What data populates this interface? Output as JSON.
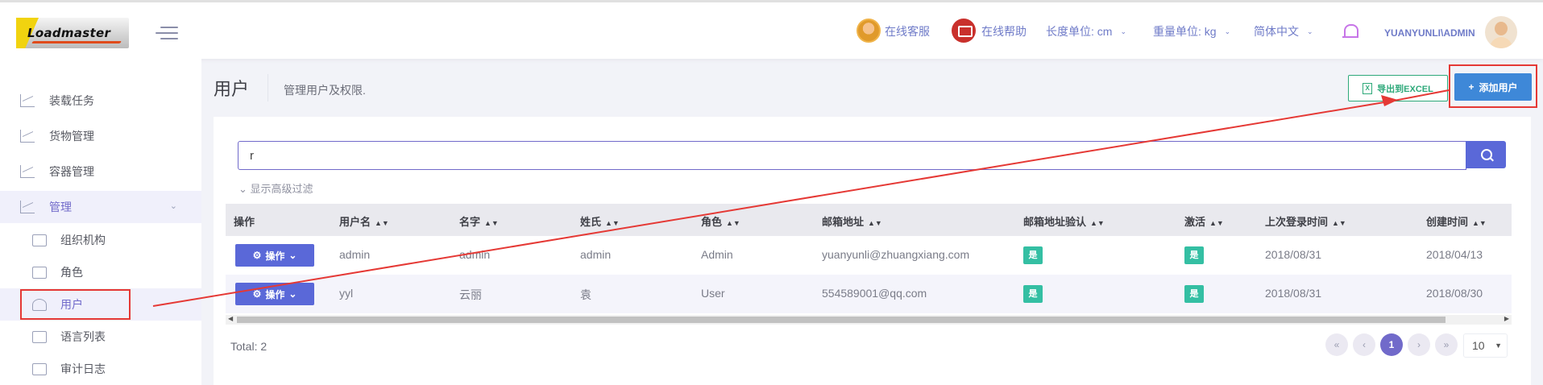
{
  "header": {
    "logo_text": "Loadmaster",
    "online_service": "在线客服",
    "online_help": "在线帮助",
    "length_unit": "长度单位: cm",
    "weight_unit": "重量单位: kg",
    "language": "简体中文",
    "user": "YUANYUNLI\\ADMIN"
  },
  "sidebar": {
    "items": [
      {
        "label": "装载任务",
        "icon": "chart-icon"
      },
      {
        "label": "货物管理",
        "icon": "chart-icon"
      },
      {
        "label": "容器管理",
        "icon": "chart-icon"
      },
      {
        "label": "管理",
        "icon": "settings-icon"
      }
    ],
    "sub_items": [
      {
        "label": "组织机构",
        "icon": "org-icon"
      },
      {
        "label": "角色",
        "icon": "briefcase-icon"
      },
      {
        "label": "用户",
        "icon": "user-icon"
      },
      {
        "label": "语言列表",
        "icon": "folder-icon"
      },
      {
        "label": "审计日志",
        "icon": "log-icon"
      }
    ]
  },
  "page": {
    "title": "用户",
    "subtitle": "管理用户及权限.",
    "export_label": "导出到EXCEL",
    "add_label": "添加用户"
  },
  "search": {
    "value": "r",
    "advanced_filter": "显示高级过滤"
  },
  "table": {
    "columns": [
      "操作",
      "用户名",
      "名字",
      "姓氏",
      "角色",
      "邮箱地址",
      "邮箱地址验认",
      "激活",
      "上次登录时间",
      "创建时间"
    ],
    "action_label": "操作",
    "rows": [
      {
        "username": "admin",
        "name": "admin",
        "surname": "admin",
        "role": "Admin",
        "email": "yuanyunli@zhuangxiang.com",
        "email_confirmed": "是",
        "active": "是",
        "last_login": "2018/08/31",
        "created": "2018/04/13"
      },
      {
        "username": "yyl",
        "name": "云丽",
        "surname": "袁",
        "role": "User",
        "email": "554589001@qq.com",
        "email_confirmed": "是",
        "active": "是",
        "last_login": "2018/08/31",
        "created": "2018/08/30"
      }
    ]
  },
  "pagination": {
    "total": "Total: 2",
    "current_page": "1",
    "page_size": "10"
  },
  "colors": {
    "accent": "#716aca",
    "primary_button": "#3e88d8",
    "success": "#34bfa3",
    "annotation": "#e53935"
  }
}
